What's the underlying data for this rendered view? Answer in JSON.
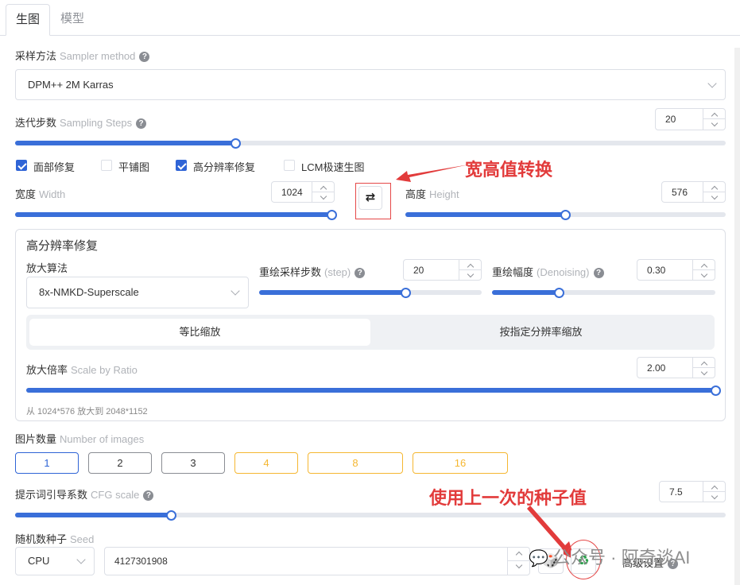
{
  "tabs": [
    "生图",
    "模型"
  ],
  "sampler": {
    "label": "采样方法",
    "label_en": "Sampler method",
    "value": "DPM++ 2M Karras"
  },
  "steps": {
    "label": "迭代步数",
    "label_en": "Sampling Steps",
    "value": "20",
    "fraction": 0.31
  },
  "checkboxes": [
    {
      "label": "面部修复",
      "checked": true
    },
    {
      "label": "平铺图",
      "checked": false
    },
    {
      "label": "高分辨率修复",
      "checked": true
    },
    {
      "label": "LCM极速生图",
      "checked": false
    }
  ],
  "width": {
    "label": "宽度",
    "label_en": "Width",
    "value": "1024",
    "fraction": 0.99
  },
  "height": {
    "label": "高度",
    "label_en": "Height",
    "value": "576",
    "fraction": 0.5
  },
  "annotations": {
    "swap": "宽高值转换",
    "seed": "使用上一次的种子值"
  },
  "hires": {
    "title": "高分辨率修复",
    "upscaler": {
      "label": "放大算法",
      "value": "8x-NMKD-Superscale"
    },
    "hires_steps": {
      "label": "重绘采样步数",
      "label_en": "(step)",
      "value": "20",
      "fraction": 0.66
    },
    "denoise": {
      "label": "重绘幅度",
      "label_en": "(Denoising)",
      "value": "0.30",
      "fraction": 0.3
    },
    "modes": [
      "等比缩放",
      "按指定分辨率缩放"
    ],
    "scale": {
      "label": "放大倍率",
      "label_en": "Scale by Ratio",
      "value": "2.00",
      "fraction": 1.0
    },
    "resize_hint": "从 1024*576 放大到 2048*1152"
  },
  "images": {
    "label": "图片数量",
    "label_en": "Number of images",
    "options": [
      "1",
      "2",
      "3",
      "4",
      "8",
      "16"
    ]
  },
  "cfg": {
    "label": "提示词引导系数",
    "label_en": "CFG scale",
    "value": "7.5",
    "fraction": 0.22
  },
  "seed": {
    "label": "随机数种子",
    "label_en": "Seed",
    "device": "CPU",
    "value": "4127301908"
  },
  "advanced": "高级设置",
  "watermark": "公众号 · 阿奇谈AI"
}
